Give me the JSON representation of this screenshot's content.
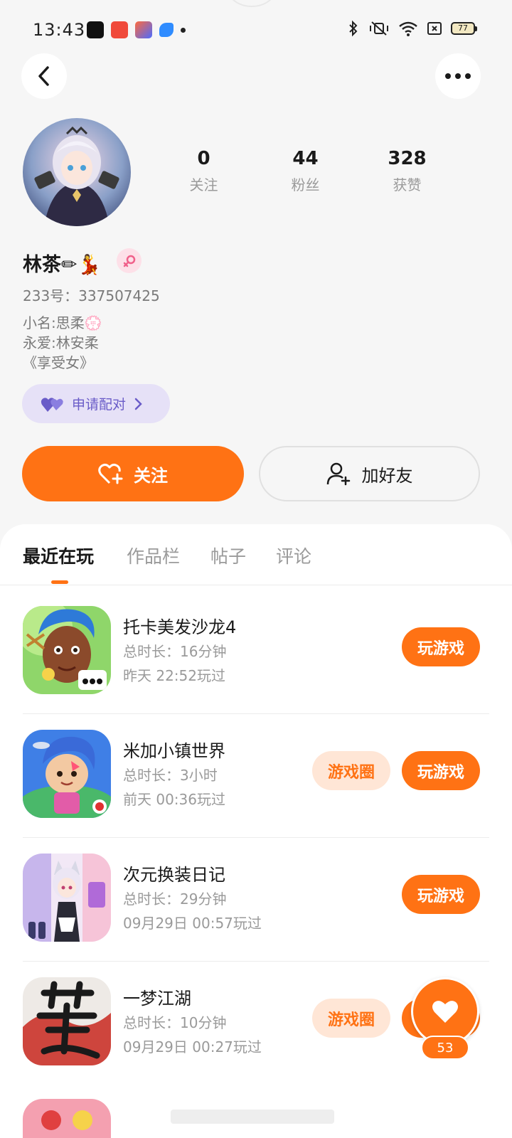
{
  "status_bar": {
    "time": "13:43",
    "battery": "77"
  },
  "profile": {
    "stats": [
      {
        "value": "0",
        "label": "关注"
      },
      {
        "value": "44",
        "label": "粉丝"
      },
      {
        "value": "328",
        "label": "获赞"
      }
    ],
    "name": "林茶✏💃",
    "id_line": "233号：337507425",
    "bio": [
      "小名:思柔💮",
      "永爱:林安柔",
      "《享受女》"
    ],
    "pair_label": "申请配对",
    "follow_label": "关注",
    "add_friend_label": "加好友"
  },
  "tabs": [
    {
      "label": "最近在玩",
      "active": true
    },
    {
      "label": "作品栏",
      "active": false
    },
    {
      "label": "帖子",
      "active": false
    },
    {
      "label": "评论",
      "active": false
    }
  ],
  "games": [
    {
      "name": "托卡美发沙龙4",
      "duration": "总时长：16分钟",
      "last_played": "昨天 22:52玩过",
      "play_label": "玩游戏",
      "circle_label": ""
    },
    {
      "name": "米加小镇世界",
      "duration": "总时长：3小时",
      "last_played": "前天 00:36玩过",
      "play_label": "玩游戏",
      "circle_label": "游戏圈"
    },
    {
      "name": "次元换装日记",
      "duration": "总时长：29分钟",
      "last_played": "09月29日 00:57玩过",
      "play_label": "玩游戏",
      "circle_label": ""
    },
    {
      "name": "一梦江湖",
      "duration": "总时长：10分钟",
      "last_played": "09月29日 00:27玩过",
      "play_label": "玩游戏",
      "circle_label": "游戏圈"
    }
  ],
  "like_fab": {
    "count": "53"
  },
  "colors": {
    "accent": "#ff7214",
    "pair_bg": "#e6e1f7",
    "pair_text": "#6a5cc8"
  }
}
